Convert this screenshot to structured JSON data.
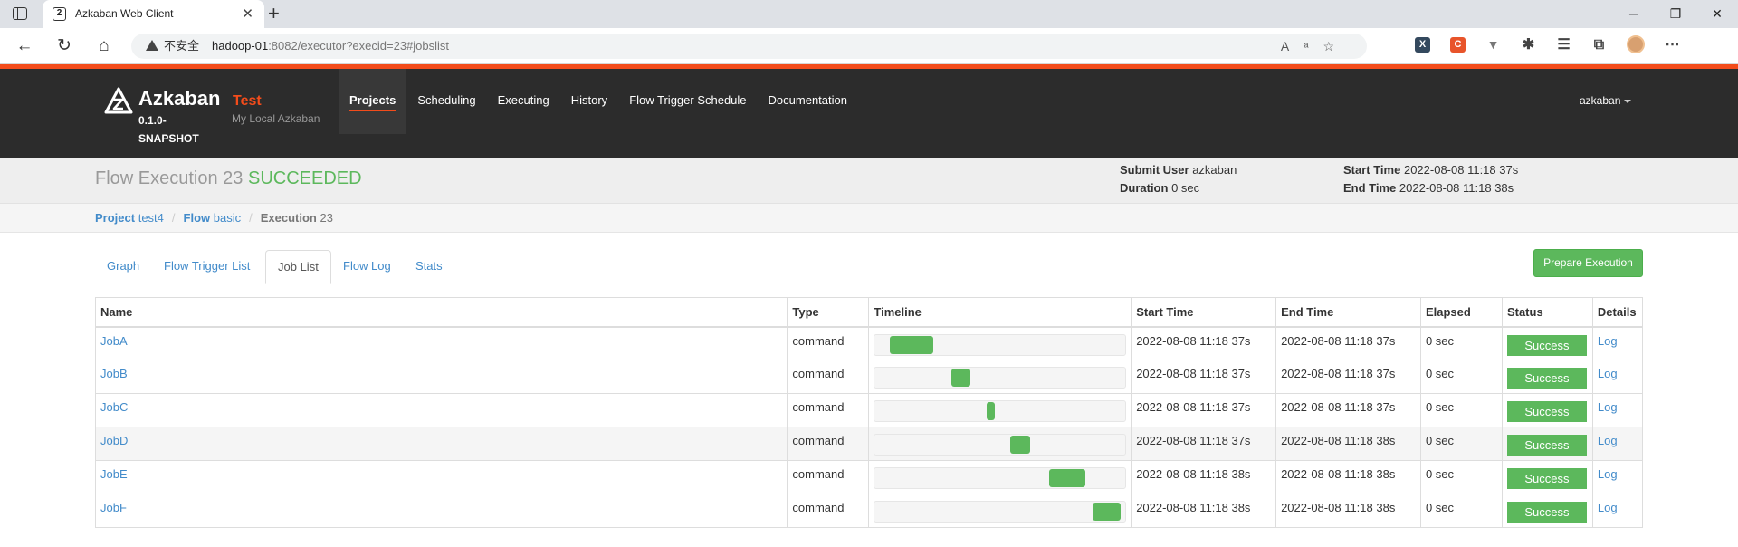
{
  "browser": {
    "tab_title": "Azkaban Web Client",
    "tab_close": "✕",
    "new_tab": "+",
    "insecure_label": "不安全",
    "url_host": "hadoop-01",
    "url_rest": ":8082/executor?execid=23#jobslist",
    "win_minimize": "─",
    "win_restore": "❐",
    "win_close": "✕"
  },
  "header": {
    "app_name": "Azkaban",
    "version": "0.1.0-SNAPSHOT",
    "env_name": "Test",
    "env_desc": "My Local Azkaban",
    "nav": [
      "Projects",
      "Scheduling",
      "Executing",
      "History",
      "Flow Trigger Schedule",
      "Documentation"
    ],
    "active_nav": "Projects",
    "user": "azkaban"
  },
  "flow": {
    "title": "Flow Execution 23",
    "status": "SUCCEEDED",
    "submit_user_label": "Submit User",
    "submit_user": "azkaban",
    "duration_label": "Duration",
    "duration": "0 sec",
    "start_time_label": "Start Time",
    "start_time": "2022-08-08 11:18 37s",
    "end_time_label": "End Time",
    "end_time": "2022-08-08 11:18 38s"
  },
  "breadcrumb": {
    "project_label": "Project",
    "project": "test4",
    "flow_label": "Flow",
    "flow": "basic",
    "execution_label": "Execution",
    "execution": "23"
  },
  "tabs": [
    "Graph",
    "Flow Trigger List",
    "Job List",
    "Flow Log",
    "Stats"
  ],
  "active_tab": "Job List",
  "prepare_button": "Prepare Execution",
  "table": {
    "columns": [
      "Name",
      "Type",
      "Timeline",
      "Start Time",
      "End Time",
      "Elapsed",
      "Status",
      "Details"
    ],
    "rows": [
      {
        "name": "JobA",
        "type": "command",
        "timeline_start": 0.06,
        "timeline_end": 0.235,
        "start": "2022-08-08 11:18 37s",
        "end": "2022-08-08 11:18 37s",
        "elapsed": "0 sec",
        "status": "Success",
        "details": "Log"
      },
      {
        "name": "JobB",
        "type": "command",
        "timeline_start": 0.305,
        "timeline_end": 0.38,
        "start": "2022-08-08 11:18 37s",
        "end": "2022-08-08 11:18 37s",
        "elapsed": "0 sec",
        "status": "Success",
        "details": "Log"
      },
      {
        "name": "JobC",
        "type": "command",
        "timeline_start": 0.445,
        "timeline_end": 0.48,
        "start": "2022-08-08 11:18 37s",
        "end": "2022-08-08 11:18 37s",
        "elapsed": "0 sec",
        "status": "Success",
        "details": "Log"
      },
      {
        "name": "JobD",
        "type": "command",
        "timeline_start": 0.54,
        "timeline_end": 0.62,
        "start": "2022-08-08 11:18 37s",
        "end": "2022-08-08 11:18 38s",
        "elapsed": "0 sec",
        "status": "Success",
        "details": "Log"
      },
      {
        "name": "JobE",
        "type": "command",
        "timeline_start": 0.695,
        "timeline_end": 0.84,
        "start": "2022-08-08 11:18 38s",
        "end": "2022-08-08 11:18 38s",
        "elapsed": "0 sec",
        "status": "Success",
        "details": "Log"
      },
      {
        "name": "JobF",
        "type": "command",
        "timeline_start": 0.87,
        "timeline_end": 0.98,
        "start": "2022-08-08 11:18 38s",
        "end": "2022-08-08 11:18 38s",
        "elapsed": "0 sec",
        "status": "Success",
        "details": "Log"
      }
    ]
  },
  "colors": {
    "accent_orange": "#f34c1b",
    "success_green": "#5cb85c",
    "link_blue": "#428bca"
  }
}
